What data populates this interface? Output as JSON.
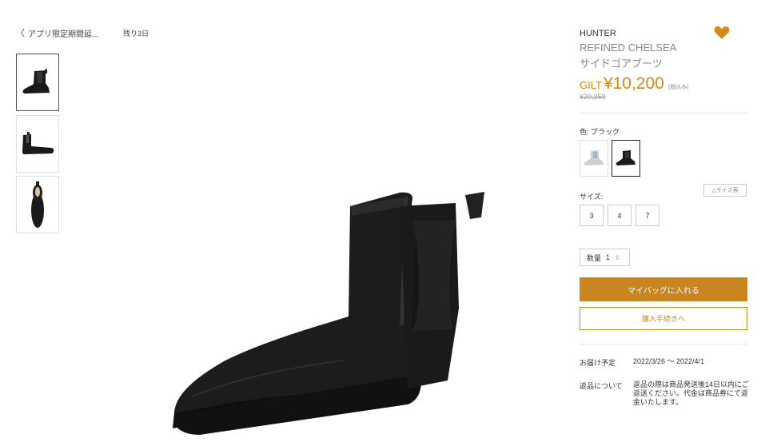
{
  "nav": {
    "back_label": "アプリ限定期間延...",
    "remaining": "残り3日"
  },
  "product": {
    "brand": "HUNTER",
    "name_line1": "REFINED CHELSEA",
    "name_line2": "サイドゴアブーツ",
    "price_label": "GILT",
    "price": "¥10,200",
    "tax_note": "(税込み)",
    "original_price": "¥20,350"
  },
  "color": {
    "label": "色: ブラック",
    "options": [
      "white-gray",
      "black"
    ],
    "selected": "black"
  },
  "size": {
    "label": "サイズ:",
    "chart_label": "△サイズ表",
    "options": [
      "3",
      "4",
      "7"
    ]
  },
  "quantity": {
    "label": "数量",
    "value": "1"
  },
  "actions": {
    "add_to_bag": "マイバッグに入れる",
    "checkout": "購入手続きへ"
  },
  "delivery": {
    "label": "お届け予定",
    "value": "2022/3/26 ～ 2022/4/1"
  },
  "returns": {
    "label": "返品について",
    "value": "返品の際は商品発送後14日以内にご返送ください。代金は商品券にて返金いたします。"
  },
  "colors": {
    "accent": "#c9851f",
    "heart": "#d48a14"
  }
}
